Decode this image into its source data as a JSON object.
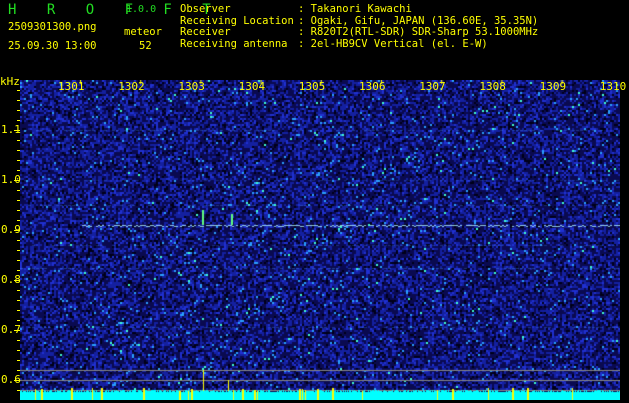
{
  "app": {
    "name": "H R O F F T",
    "version": "1.0.0"
  },
  "file": {
    "name": "2509301300.png",
    "datetime": "25.09.30 13:00"
  },
  "count": {
    "label": "meteor",
    "value": "52"
  },
  "info": [
    {
      "key": "Observer",
      "value": "Takanori Kawachi"
    },
    {
      "key": "Receiving Location",
      "value": "Ogaki, Gifu, JAPAN (136.60E, 35.35N)"
    },
    {
      "key": "Receiver",
      "value": "R820T2(RTL-SDR) SDR-Sharp 53.1000MHz"
    },
    {
      "key": "Receiving antenna",
      "value": "2el-HB9CV Vertical (el. E-W)"
    }
  ],
  "axis": {
    "y_unit": "kHz",
    "x_ticks": [
      "1301",
      "1302",
      "1303",
      "1304",
      "1305",
      "1306",
      "1307",
      "1308",
      "1309",
      "1310"
    ],
    "y_ticks": [
      "1.1",
      "1.0",
      "0.9",
      "0.8",
      "0.7",
      "0.6"
    ]
  },
  "colors": {
    "text": "#ffff00",
    "title": "#22dd22",
    "background": "#000000",
    "spectrum": "#00ffff"
  }
}
